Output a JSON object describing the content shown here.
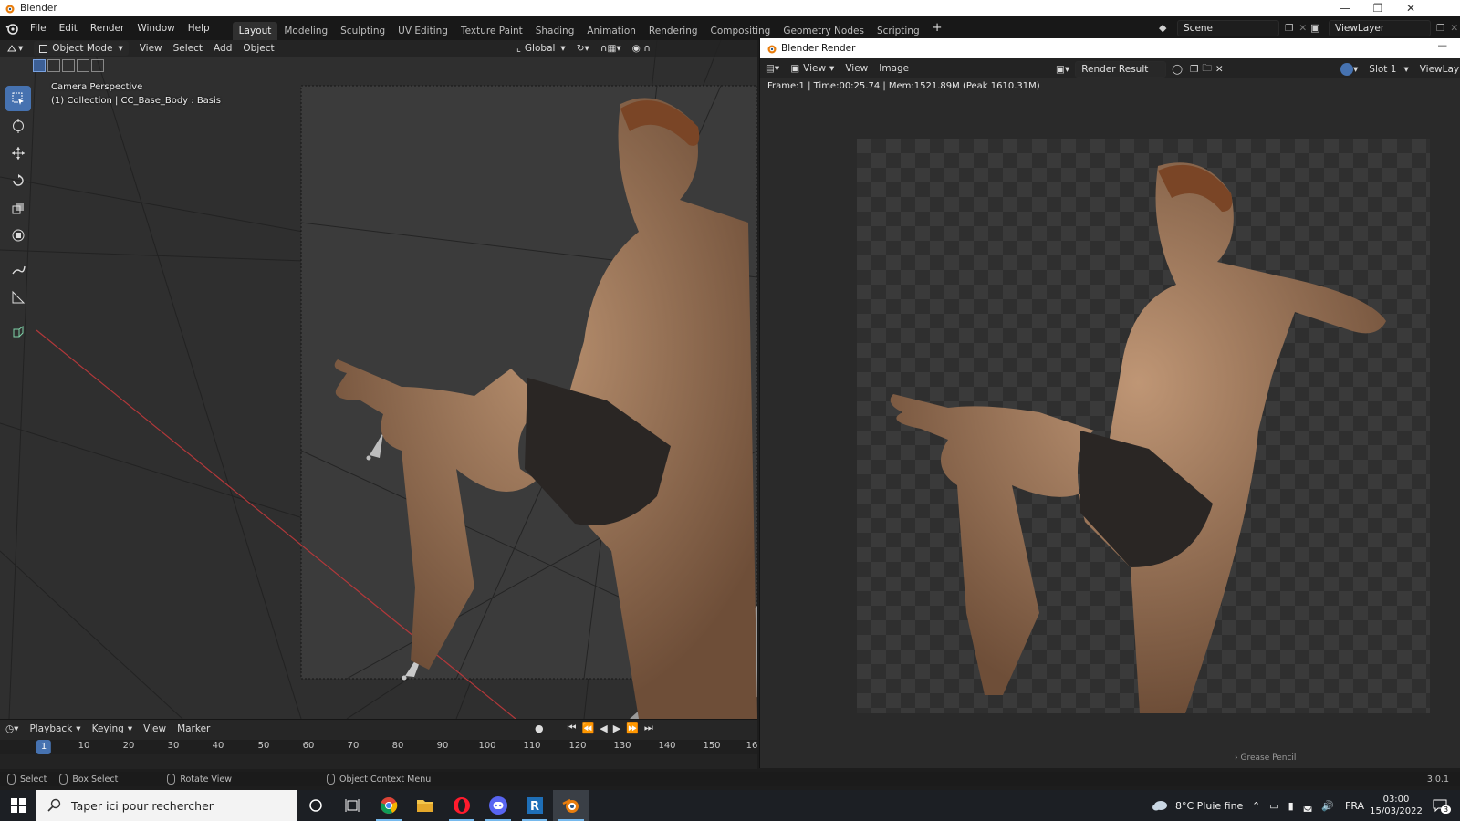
{
  "window": {
    "title": "Blender"
  },
  "topbar": {
    "menus": [
      "File",
      "Edit",
      "Render",
      "Window",
      "Help"
    ],
    "workspaces": [
      "Layout",
      "Modeling",
      "Sculpting",
      "UV Editing",
      "Texture Paint",
      "Shading",
      "Animation",
      "Rendering",
      "Compositing",
      "Geometry Nodes",
      "Scripting"
    ],
    "active_workspace": "Layout",
    "add_workspace": "+",
    "scene": "Scene",
    "view_layer": "ViewLayer"
  },
  "viewport": {
    "mode": "Object Mode",
    "menus": [
      "View",
      "Select",
      "Add",
      "Object"
    ],
    "transform_orientation": "Global",
    "overlay_line1": "Camera Perspective",
    "overlay_line2": "(1) Collection | CC_Base_Body : Basis",
    "tools": [
      "select-box",
      "cursor",
      "move",
      "rotate",
      "scale",
      "transform",
      "annotate",
      "measure",
      "add-cube"
    ]
  },
  "timeline": {
    "menus": [
      "Playback",
      "Keying",
      "View",
      "Marker"
    ],
    "current_frame": "1",
    "ticks": [
      "10",
      "20",
      "30",
      "40",
      "50",
      "60",
      "70",
      "80",
      "90",
      "100",
      "110",
      "120",
      "130",
      "140",
      "150",
      "16"
    ]
  },
  "render_window": {
    "title": "Blender Render",
    "menus": [
      "View",
      "View",
      "Image"
    ],
    "image_name": "Render Result",
    "slot": "Slot 1",
    "view_layer": "ViewLay",
    "info": "Frame:1 | Time:00:25.74 | Mem:1521.89M (Peak 1610.31M)",
    "grease_pencil": "Grease Pencil"
  },
  "statusbar": {
    "select": "Select",
    "box_select": "Box Select",
    "rotate_view": "Rotate View",
    "context_menu": "Object Context Menu",
    "version": "3.0.1"
  },
  "taskbar": {
    "search_placeholder": "Taper ici pour rechercher",
    "weather": "8°C  Pluie fine",
    "language": "FRA",
    "time": "03:00",
    "date": "15/03/2022",
    "notifications": "3"
  }
}
